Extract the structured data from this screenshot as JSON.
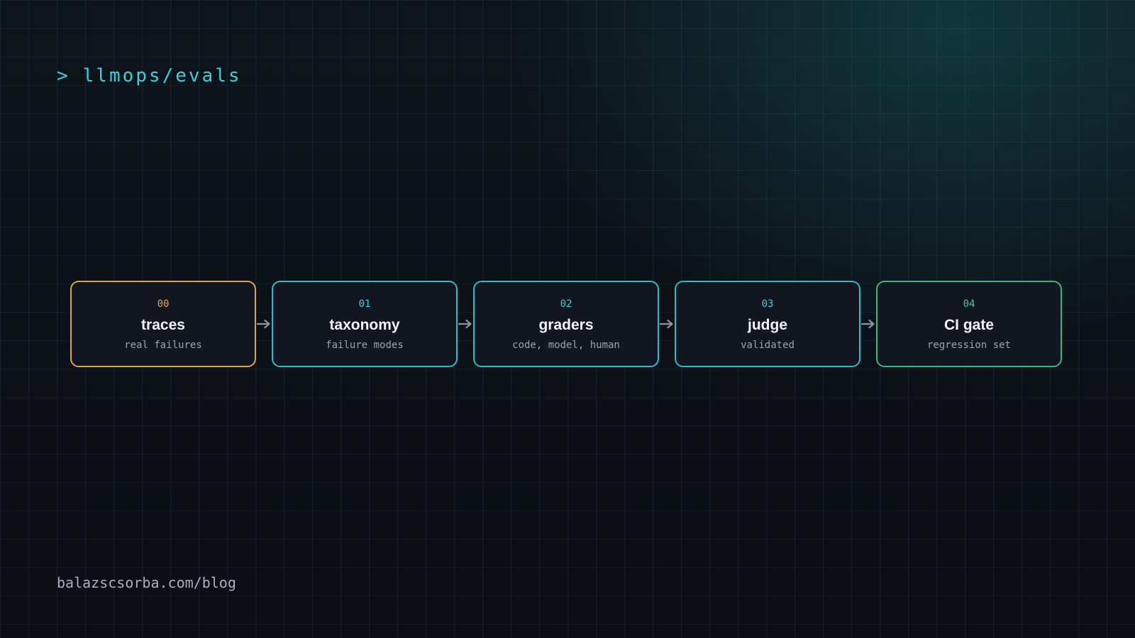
{
  "header": {
    "prompt_symbol": ">",
    "path": "llmops/evals"
  },
  "pipeline": {
    "stages": [
      {
        "number": "00",
        "title": "traces",
        "subtitle": "real failures",
        "accent": "#e0a447"
      },
      {
        "number": "01",
        "title": "taxonomy",
        "subtitle": "failure modes",
        "accent": "#2cbcc6"
      },
      {
        "number": "02",
        "title": "graders",
        "subtitle": "code, model, human",
        "accent": "#2cbcc6"
      },
      {
        "number": "03",
        "title": "judge",
        "subtitle": "validated",
        "accent": "#2cbcc6"
      },
      {
        "number": "04",
        "title": "CI gate",
        "subtitle": "regression set",
        "accent": "#36b87a"
      }
    ],
    "connector_icon": "arrow-right-icon"
  },
  "footer": {
    "url": "balazscsorba.com/blog"
  },
  "colors": {
    "background": "#0b0e14",
    "accent_cyan": "#3ccfdc",
    "accent_amber": "#e0a447",
    "accent_green": "#36b87a",
    "box_fill": "#121620"
  }
}
